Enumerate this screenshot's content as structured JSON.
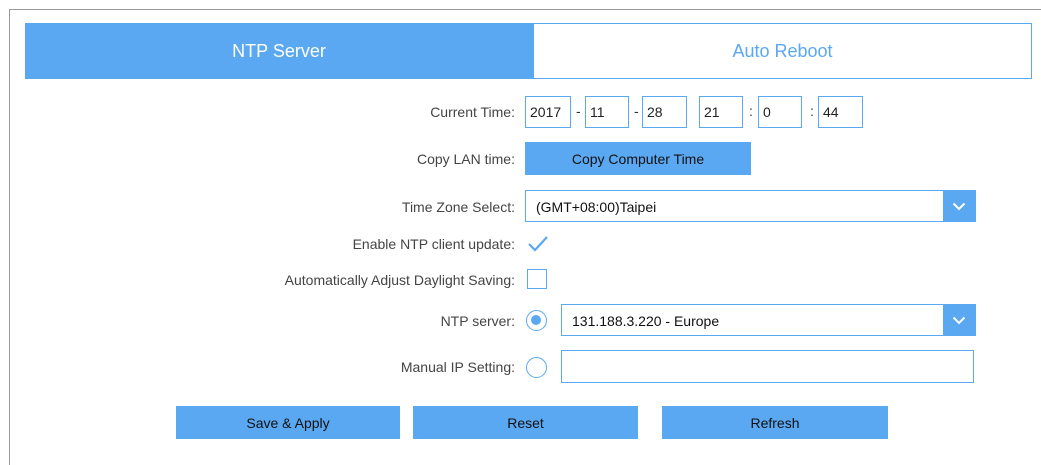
{
  "tabs": [
    {
      "label": "NTP Server",
      "active": true
    },
    {
      "label": "Auto Reboot",
      "active": false
    }
  ],
  "form": {
    "current_time": {
      "label": "Current Time:",
      "year": "2017",
      "month": "11",
      "day": "28",
      "hour": "21",
      "minute": "0",
      "second": "44",
      "sep_date": "-",
      "sep_time": ":"
    },
    "copy_lan_time": {
      "label": "Copy LAN time:",
      "button": "Copy Computer Time"
    },
    "time_zone": {
      "label": "Time Zone Select:",
      "value": "(GMT+08:00)Taipei"
    },
    "enable_ntp": {
      "label": "Enable NTP client update:",
      "checked": true
    },
    "daylight_saving": {
      "label": "Automatically Adjust Daylight Saving:",
      "checked": false
    },
    "ntp_server": {
      "label": "NTP server:",
      "selected": true,
      "value": "131.188.3.220 - Europe"
    },
    "manual_ip": {
      "label": "Manual IP Setting:",
      "selected": false,
      "value": ""
    }
  },
  "buttons": {
    "save": "Save & Apply",
    "reset": "Reset",
    "refresh": "Refresh"
  },
  "colors": {
    "accent": "#5aa8f2"
  },
  "icons": {
    "dropdown": "chevron-down-icon",
    "check": "check-icon"
  }
}
